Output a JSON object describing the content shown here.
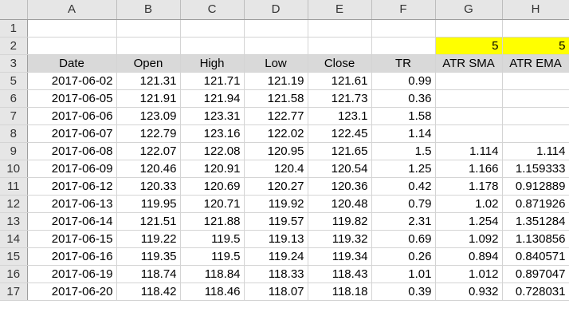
{
  "sheet": {
    "columns": [
      "A",
      "B",
      "C",
      "D",
      "E",
      "F",
      "G",
      "H"
    ],
    "highlight_color": "#ffff00",
    "header_fill_color": "#d9d9d9",
    "rows": [
      {
        "num": "1",
        "cells": [
          "",
          "",
          "",
          "",
          "",
          "",
          "",
          ""
        ]
      },
      {
        "num": "2",
        "cells": [
          "",
          "",
          "",
          "",
          "",
          "",
          "5",
          "5"
        ]
      },
      {
        "num": "3",
        "cells": [
          "Date",
          "Open",
          "High",
          "Low",
          "Close",
          "TR",
          "ATR SMA",
          "ATR EMA"
        ]
      },
      {
        "num": "5",
        "cells": [
          "2017-06-02",
          "121.31",
          "121.71",
          "121.19",
          "121.61",
          "0.99",
          "",
          ""
        ]
      },
      {
        "num": "6",
        "cells": [
          "2017-06-05",
          "121.91",
          "121.94",
          "121.58",
          "121.73",
          "0.36",
          "",
          ""
        ]
      },
      {
        "num": "7",
        "cells": [
          "2017-06-06",
          "123.09",
          "123.31",
          "122.77",
          "123.1",
          "1.58",
          "",
          ""
        ]
      },
      {
        "num": "8",
        "cells": [
          "2017-06-07",
          "122.79",
          "123.16",
          "122.02",
          "122.45",
          "1.14",
          "",
          ""
        ]
      },
      {
        "num": "9",
        "cells": [
          "2017-06-08",
          "122.07",
          "122.08",
          "120.95",
          "121.65",
          "1.5",
          "1.114",
          "1.114"
        ]
      },
      {
        "num": "10",
        "cells": [
          "2017-06-09",
          "120.46",
          "120.91",
          "120.4",
          "120.54",
          "1.25",
          "1.166",
          "1.159333"
        ]
      },
      {
        "num": "11",
        "cells": [
          "2017-06-12",
          "120.33",
          "120.69",
          "120.27",
          "120.36",
          "0.42",
          "1.178",
          "0.912889"
        ]
      },
      {
        "num": "12",
        "cells": [
          "2017-06-13",
          "119.95",
          "120.71",
          "119.92",
          "120.48",
          "0.79",
          "1.02",
          "0.871926"
        ]
      },
      {
        "num": "13",
        "cells": [
          "2017-06-14",
          "121.51",
          "121.88",
          "119.57",
          "119.82",
          "2.31",
          "1.254",
          "1.351284"
        ]
      },
      {
        "num": "14",
        "cells": [
          "2017-06-15",
          "119.22",
          "119.5",
          "119.13",
          "119.32",
          "0.69",
          "1.092",
          "1.130856"
        ]
      },
      {
        "num": "15",
        "cells": [
          "2017-06-16",
          "119.35",
          "119.5",
          "119.24",
          "119.34",
          "0.26",
          "0.894",
          "0.840571"
        ]
      },
      {
        "num": "16",
        "cells": [
          "2017-06-19",
          "118.74",
          "118.84",
          "118.33",
          "118.43",
          "1.01",
          "1.012",
          "0.897047"
        ]
      },
      {
        "num": "17",
        "cells": [
          "2017-06-20",
          "118.42",
          "118.46",
          "118.07",
          "118.18",
          "0.39",
          "0.932",
          "0.728031"
        ]
      }
    ]
  }
}
